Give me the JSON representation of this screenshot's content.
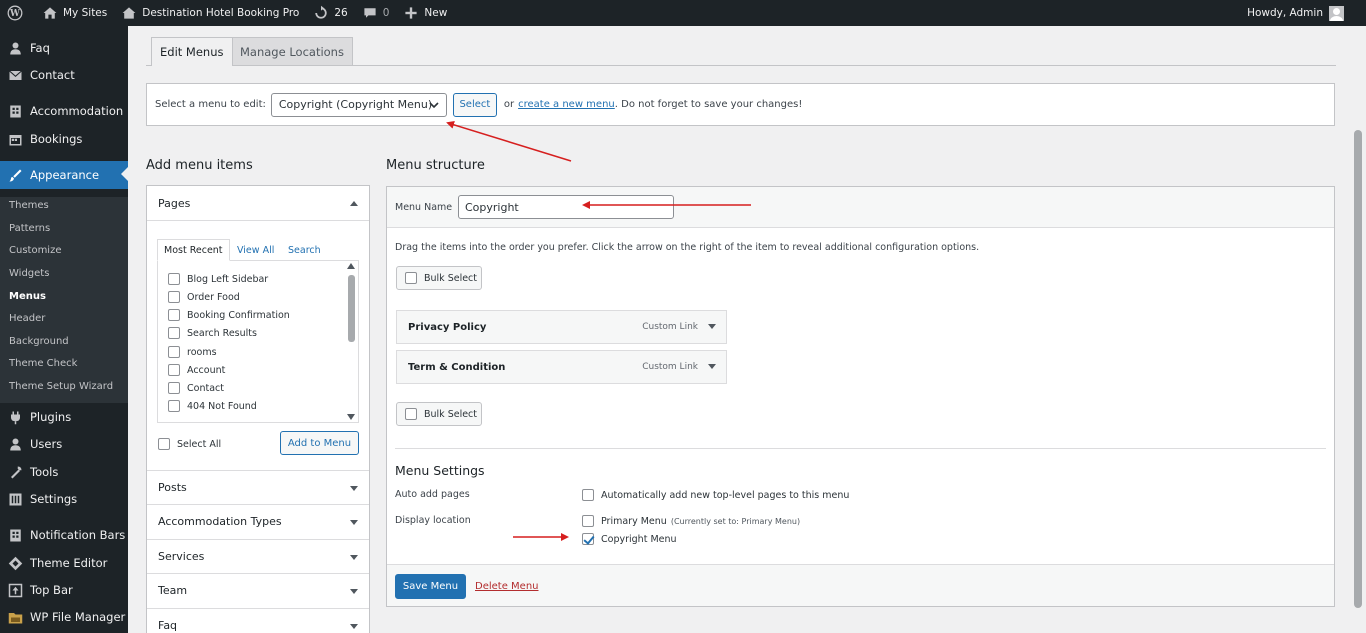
{
  "adminbar": {
    "my_sites": "My Sites",
    "site_name": "Destination Hotel Booking Pro",
    "updates_count": "26",
    "comments_count": "0",
    "new_label": "New",
    "howdy": "Howdy, Admin"
  },
  "sidebar": {
    "items": [
      {
        "label": "Faq",
        "icon": "user-icon"
      },
      {
        "label": "Contact",
        "icon": "mail-icon"
      },
      {
        "label": "Accommodation",
        "icon": "building-icon"
      },
      {
        "label": "Bookings",
        "icon": "calendar-icon"
      },
      {
        "label": "Appearance",
        "icon": "brush-icon"
      },
      {
        "label": "Plugins",
        "icon": "plugin-icon"
      },
      {
        "label": "Users",
        "icon": "users-icon"
      },
      {
        "label": "Tools",
        "icon": "wrench-icon"
      },
      {
        "label": "Settings",
        "icon": "settings-icon"
      },
      {
        "label": "Notification Bars",
        "icon": "building-icon"
      },
      {
        "label": "Theme Editor",
        "icon": "diamond-icon"
      },
      {
        "label": "Top Bar",
        "icon": "upload-icon"
      },
      {
        "label": "WP File Manager",
        "icon": "folder-icon"
      }
    ],
    "appearance_submenu": [
      "Themes",
      "Patterns",
      "Customize",
      "Widgets",
      "Menus",
      "Header",
      "Background",
      "Theme Check",
      "Theme Setup Wizard"
    ]
  },
  "tabs": {
    "edit_menus": "Edit Menus",
    "manage_locations": "Manage Locations"
  },
  "manage": {
    "select_label": "Select a menu to edit:",
    "selected_menu": "Copyright (Copyright Menu)",
    "select_button": "Select",
    "or_text": "or",
    "create_link": "create a new menu",
    "reminder": ". Do not forget to save your changes!"
  },
  "add_items": {
    "heading": "Add menu items",
    "pages_title": "Pages",
    "inner_tabs": [
      "Most Recent",
      "View All",
      "Search"
    ],
    "pages": [
      "Blog Left Sidebar",
      "Order Food",
      "Booking Confirmation",
      "Search Results",
      "rooms",
      "Account",
      "Contact",
      "404 Not Found"
    ],
    "select_all": "Select All",
    "add_button": "Add to Menu",
    "sections": [
      "Posts",
      "Accommodation Types",
      "Services",
      "Team",
      "Faq"
    ]
  },
  "structure": {
    "heading": "Menu structure",
    "name_label": "Menu Name",
    "name_value": "Copyright",
    "instructions": "Drag the items into the order you prefer. Click the arrow on the right of the item to reveal additional configuration options.",
    "bulk_select": "Bulk Select",
    "items": [
      {
        "title": "Privacy Policy",
        "type": "Custom Link"
      },
      {
        "title": "Term & Condition",
        "type": "Custom Link"
      }
    ],
    "settings_heading": "Menu Settings",
    "auto_add_label": "Auto add pages",
    "auto_add_text": "Automatically add new top-level pages to this menu",
    "display_location_label": "Display location",
    "primary_menu": "Primary Menu",
    "primary_note": "(Currently set to: Primary Menu)",
    "copyright_menu": "Copyright Menu",
    "save_button": "Save Menu",
    "delete_link": "Delete Menu"
  },
  "colors": {
    "admin_dark": "#1d2327",
    "accent": "#2271b1",
    "annotation": "#d61f1f",
    "danger": "#b32d2e"
  }
}
